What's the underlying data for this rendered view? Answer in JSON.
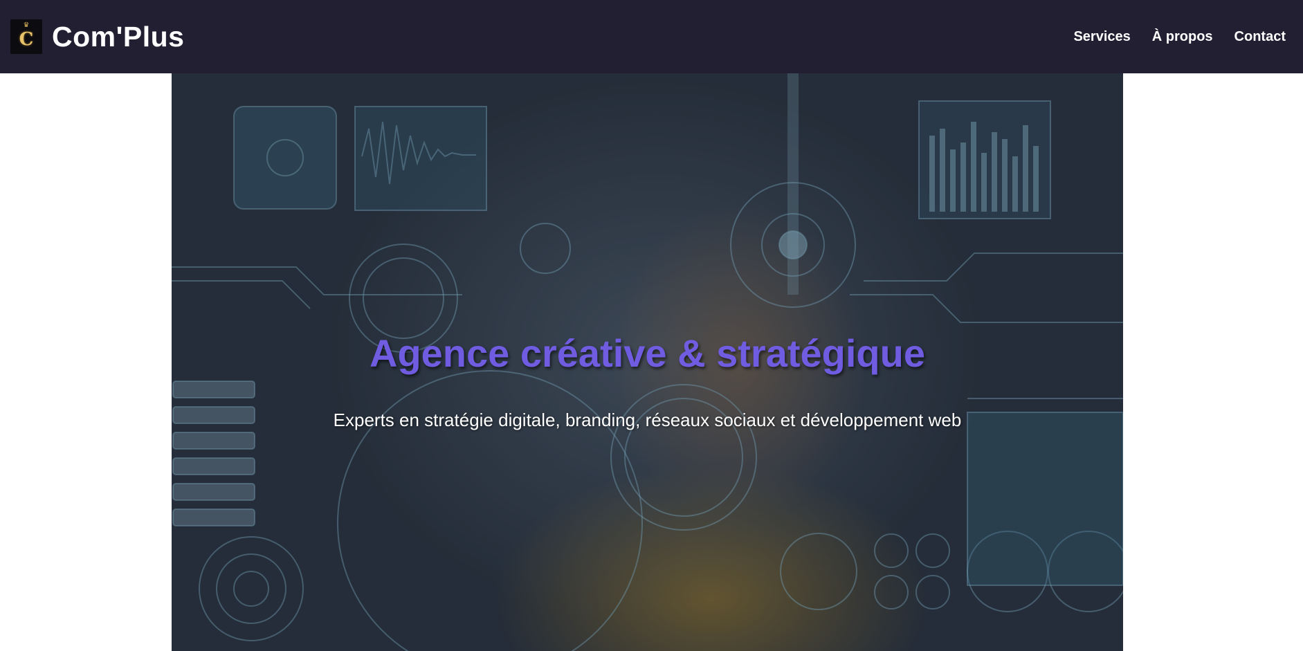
{
  "header": {
    "brand_name": "Com'Plus",
    "logo_letter": "C",
    "nav": [
      {
        "label": "Services"
      },
      {
        "label": "À propos"
      },
      {
        "label": "Contact"
      }
    ]
  },
  "hero": {
    "title": "Agence créative & stratégique",
    "subtitle": "Experts en stratégie digitale, branding, réseaux sociaux et développement web"
  },
  "colors": {
    "header_bg": "#221f33",
    "accent": "#6f5ce0",
    "page_bg": "#ffffff"
  }
}
